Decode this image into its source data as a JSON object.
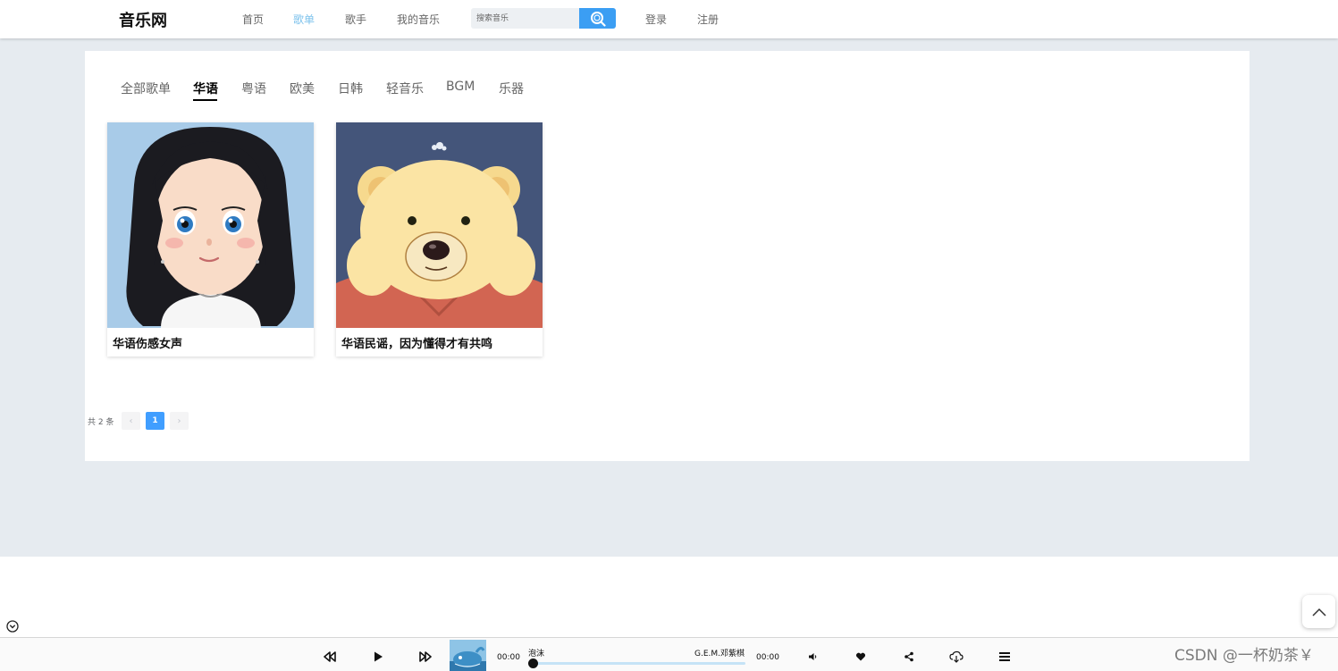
{
  "header": {
    "logo": "音乐网",
    "nav": [
      "首页",
      "歌单",
      "歌手",
      "我的音乐"
    ],
    "active_nav": "歌单",
    "search": {
      "placeholder": "搜索音乐"
    },
    "auth": {
      "login": "登录",
      "register": "注册"
    }
  },
  "categories": {
    "tabs": [
      "全部歌单",
      "华语",
      "粤语",
      "欧美",
      "日韩",
      "轻音乐",
      "BGM",
      "乐器"
    ],
    "active": "华语"
  },
  "playlists": [
    {
      "title": "华语伤感女声",
      "cover": "cartoon girl with long black hair"
    },
    {
      "title": "华语民谣，因为懂得才有共鸣",
      "cover": "cartoon yellow teddy bear"
    }
  ],
  "pagination": {
    "total_label": "共 2 条",
    "prev": "‹",
    "next": "›",
    "current_page": "1"
  },
  "player": {
    "current_time": "00:00",
    "total_time": "00:00",
    "song": "泡沫",
    "artist": "G.E.M.邓紫棋",
    "progress": 0,
    "icons": [
      "prev-icon",
      "play-icon",
      "next-icon",
      "volume-icon",
      "heart-icon",
      "share-icon",
      "download-icon",
      "playlist-menu-icon"
    ]
  },
  "watermark": "CSDN @一杯奶茶￥",
  "colors": {
    "accent": "#409eff",
    "search_button": "#3b9ef3",
    "active_nav": "#7cc2ec",
    "page_background": "#e6ebf0"
  }
}
